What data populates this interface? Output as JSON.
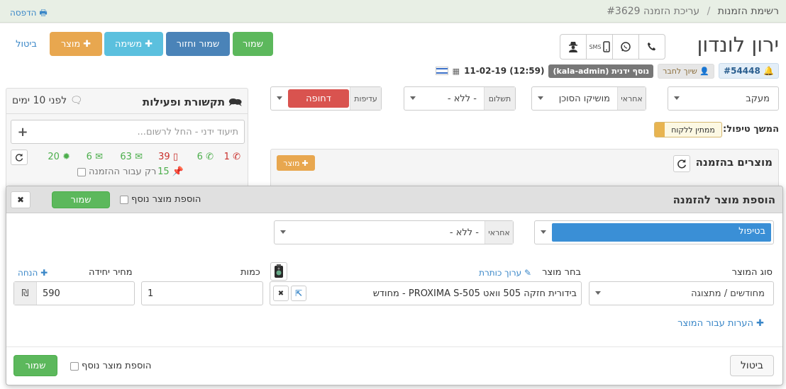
{
  "breadcrumb": {
    "root": "רשימת הזמנות",
    "current": "עריכת הזמנה #3629"
  },
  "print_label": "הדפסה",
  "customer": {
    "name": "ירון לונדון",
    "sms_label": "SMS",
    "date": "(12:59) 11-02-19",
    "added_by": "נוסף ידנית (kala-admin)",
    "link_label": "שיוך לחבר",
    "order_ref": "#54448"
  },
  "actions": {
    "save": "שמור",
    "save_return": "שמור וחזור",
    "task": "משימה",
    "product": "מוצר",
    "cancel": "ביטול"
  },
  "sidebar": {
    "title": "תקשורת ופעילות",
    "time": "לפני 10 ימים",
    "note_placeholder": "תיעוד ידני - החל לרשום...",
    "stats": {
      "calls": "1",
      "whatsapp": "6",
      "mobile": "39",
      "messages": "63",
      "email": "6",
      "points": "20",
      "pins": "15"
    },
    "only_order_label": "רק עבור ההזמנה"
  },
  "order_fields": {
    "status_value": "מעקב",
    "agent_addon": "אחראי",
    "agent_value": "מושיקו הסוכן",
    "payment_addon": "תשלום",
    "payment_value": "- ללא -",
    "priority_addon": "עדיפות",
    "priority_value": "דחופה"
  },
  "followup": {
    "label": "המשך טיפול:",
    "badge": "ממתין ללקוח"
  },
  "products": {
    "title": "מוצרים בהזמנה",
    "add_label": "מוצר"
  },
  "modal": {
    "title": "הוספת מוצר להזמנה",
    "add_another": "הוספת מוצר נוסף",
    "save": "שמור",
    "cancel": "ביטול",
    "status_value": "בטיפול",
    "agent_addon": "אחראי",
    "agent_value": "- ללא -",
    "product_type_label": "סוג המוצר",
    "product_type_value": "מחודשים / מתצוגה",
    "choose_product_label": "בחר מוצר",
    "edit_title_label": "ערוך כותרת",
    "product_value": "בידורית חזקה 505 וואט PROXIMA S-505 - מחודש",
    "qty_label": "כמות",
    "qty_value": "1",
    "unit_price_label": "מחיר יחידה",
    "discount_label": "הנחה",
    "unit_price_value": "590",
    "currency": "₪",
    "notes_label": "הערות עבור המוצר"
  },
  "colors": {
    "green": "#5cb85c",
    "blue": "#4a83b8",
    "cyan": "#5bc0de",
    "orange": "#e8a74f",
    "red": "#d9534f",
    "status_blue": "#3a8fd6"
  }
}
